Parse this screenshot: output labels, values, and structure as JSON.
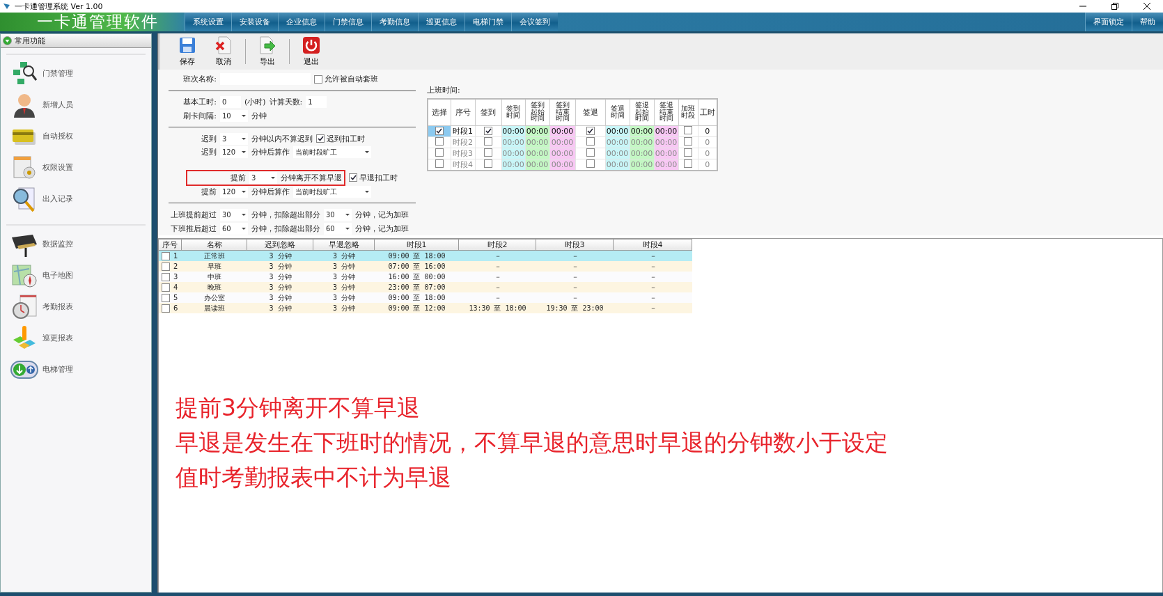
{
  "window": {
    "title": "一卡通管理系统  Ver 1.00"
  },
  "banner": {
    "app_name": "一卡通管理软件",
    "menu": [
      {
        "label": "系统设置"
      },
      {
        "label": "安装设备"
      },
      {
        "label": "企业信息"
      },
      {
        "label": "门禁信息"
      },
      {
        "label": "考勤信息"
      },
      {
        "label": "巡更信息"
      },
      {
        "label": "电梯门禁"
      },
      {
        "label": "会议签到"
      }
    ],
    "right_menu": [
      {
        "label": "界面锁定"
      },
      {
        "label": "帮助"
      }
    ]
  },
  "sidebar": {
    "header": "常用功能",
    "groups": [
      [
        {
          "label": "门禁管理"
        },
        {
          "label": "新增人员"
        },
        {
          "label": "自动授权"
        },
        {
          "label": "权限设置"
        },
        {
          "label": "出入记录"
        }
      ],
      [
        {
          "label": "数据监控"
        },
        {
          "label": "电子地图"
        },
        {
          "label": "考勤报表"
        },
        {
          "label": "巡更报表"
        },
        {
          "label": "电梯管理"
        }
      ]
    ]
  },
  "toolbar": [
    {
      "label": "保存",
      "kind": "save"
    },
    {
      "label": "取消",
      "kind": "cancel"
    },
    {
      "label": "导出",
      "kind": "export"
    },
    {
      "label": "退出",
      "kind": "exit"
    }
  ],
  "form": [
    {
      "kind": "row",
      "highlighted": false,
      "parts": [
        {
          "kind": "label",
          "text": "班次名称:"
        },
        {
          "kind": "input"
        },
        {
          "kind": "checkbox",
          "text": "允许被自动套班",
          "checked": false
        }
      ]
    },
    {
      "kind": "divider"
    },
    {
      "kind": "row",
      "highlighted": false,
      "parts": [
        {
          "kind": "label",
          "text": "基本工时:"
        },
        {
          "kind": "input",
          "value": "0"
        },
        {
          "kind": "text",
          "text": "(小时)"
        },
        {
          "kind": "text",
          "text": "计算天数:"
        },
        {
          "kind": "input",
          "value": "1"
        }
      ]
    },
    {
      "kind": "row",
      "highlighted": false,
      "parts": [
        {
          "kind": "label",
          "text": "刷卡间隔:"
        },
        {
          "kind": "select",
          "value": "10"
        },
        {
          "kind": "text",
          "text": "分钟"
        }
      ]
    },
    {
      "kind": "divider"
    },
    {
      "kind": "row",
      "highlighted": false,
      "parts": [
        {
          "kind": "label",
          "text": "迟到"
        },
        {
          "kind": "select",
          "value": "3"
        },
        {
          "kind": "text",
          "text": "分钟以内不算迟到"
        },
        {
          "kind": "checkbox",
          "text": "迟到扣工时",
          "checked": true
        }
      ]
    },
    {
      "kind": "row",
      "highlighted": false,
      "parts": [
        {
          "kind": "label",
          "text": "迟到"
        },
        {
          "kind": "select",
          "value": "120"
        },
        {
          "kind": "text",
          "text": "分钟后算作"
        },
        {
          "kind": "select",
          "value": "当前时段旷工"
        }
      ]
    },
    {
      "kind": "spacer"
    },
    {
      "kind": "row",
      "highlighted": true,
      "parts": [
        {
          "kind": "label",
          "text": "提前"
        },
        {
          "kind": "select",
          "value": "3"
        },
        {
          "kind": "text",
          "text": "分钟离开不算早退"
        },
        {
          "kind": "checkbox",
          "text": "早退扣工时",
          "checked": true
        }
      ]
    },
    {
      "kind": "row",
      "highlighted": false,
      "parts": [
        {
          "kind": "label",
          "text": "提前"
        },
        {
          "kind": "select",
          "value": "120"
        },
        {
          "kind": "text",
          "text": "分钟后算作"
        },
        {
          "kind": "select",
          "value": "当前时段旷工"
        }
      ]
    },
    {
      "kind": "divider"
    },
    {
      "kind": "row",
      "highlighted": false,
      "parts": [
        {
          "kind": "label",
          "text": "上班提前超过"
        },
        {
          "kind": "select",
          "value": "30"
        },
        {
          "kind": "text",
          "text": "分钟，扣除超出部分"
        },
        {
          "kind": "select",
          "value": "30"
        },
        {
          "kind": "text",
          "text": "分钟，记为加班"
        }
      ]
    },
    {
      "kind": "row",
      "highlighted": false,
      "parts": [
        {
          "kind": "label",
          "text": "下班推后超过"
        },
        {
          "kind": "select",
          "value": "60"
        },
        {
          "kind": "text",
          "text": "分钟，扣除超出部分"
        },
        {
          "kind": "select",
          "value": "60"
        },
        {
          "kind": "text",
          "text": "分钟，记为加班"
        }
      ]
    }
  ],
  "periods": {
    "title": "上班时间:",
    "columns": [
      "选择",
      "序号",
      "签到",
      "签到时间",
      "签到起始时间",
      "签到结束时间",
      "签退",
      "签退时间",
      "签退起始时间",
      "签退结束时间",
      "加班时段",
      "工时"
    ],
    "rows": [
      {
        "selected": true,
        "active": true,
        "name": "时段1",
        "sign_in": true,
        "in_times": [
          "00:00",
          "00:00",
          "00:00"
        ],
        "sign_out": true,
        "out_times": [
          "00:00",
          "00:00",
          "00:00"
        ],
        "overtime": false,
        "hours": "0"
      },
      {
        "selected": false,
        "active": false,
        "name": "时段2",
        "sign_in": false,
        "in_times": [
          "00:00",
          "00:00",
          "00:00"
        ],
        "sign_out": false,
        "out_times": [
          "00:00",
          "00:00",
          "00:00"
        ],
        "overtime": false,
        "hours": "0"
      },
      {
        "selected": false,
        "active": false,
        "name": "时段3",
        "sign_in": false,
        "in_times": [
          "00:00",
          "00:00",
          "00:00"
        ],
        "sign_out": false,
        "out_times": [
          "00:00",
          "00:00",
          "00:00"
        ],
        "overtime": false,
        "hours": "0"
      },
      {
        "selected": false,
        "active": false,
        "name": "时段4",
        "sign_in": false,
        "in_times": [
          "00:00",
          "00:00",
          "00:00"
        ],
        "sign_out": false,
        "out_times": [
          "00:00",
          "00:00",
          "00:00"
        ],
        "overtime": false,
        "hours": "0"
      }
    ]
  },
  "shifts": {
    "columns": [
      "序号",
      "名称",
      "迟到忽略",
      "早退忽略",
      "时段1",
      "时段2",
      "时段3",
      "时段4"
    ],
    "rows": [
      {
        "checked": false,
        "selected": true,
        "cells": [
          "1",
          "正常班",
          "3 分钟",
          "3 分钟",
          "09:00 至 18:00",
          "－",
          "－",
          "－"
        ]
      },
      {
        "checked": false,
        "selected": false,
        "cells": [
          "2",
          "早班",
          "3 分钟",
          "3 分钟",
          "07:00 至 16:00",
          "－",
          "－",
          "－"
        ]
      },
      {
        "checked": false,
        "selected": false,
        "cells": [
          "3",
          "中班",
          "3 分钟",
          "3 分钟",
          "16:00 至 00:00",
          "－",
          "－",
          "－"
        ]
      },
      {
        "checked": false,
        "selected": false,
        "cells": [
          "4",
          "晚班",
          "3 分钟",
          "3 分钟",
          "23:00 至 07:00",
          "－",
          "－",
          "－"
        ]
      },
      {
        "checked": false,
        "selected": false,
        "cells": [
          "5",
          "办公室",
          "3 分钟",
          "3 分钟",
          "09:00 至 18:00",
          "－",
          "－",
          "－"
        ]
      },
      {
        "checked": false,
        "selected": false,
        "cells": [
          "6",
          "晨读班",
          "3 分钟",
          "3 分钟",
          "09:00 至 12:00",
          "13:30 至 18:00",
          "19:30 至 23:00",
          "－"
        ]
      }
    ]
  },
  "caption": [
    "提前3分钟离开不算早退",
    "早退是发生在下班时的情况，不算早退的意思时早退的分钟数小于设定",
    "值时考勤报表中不计为早退"
  ]
}
